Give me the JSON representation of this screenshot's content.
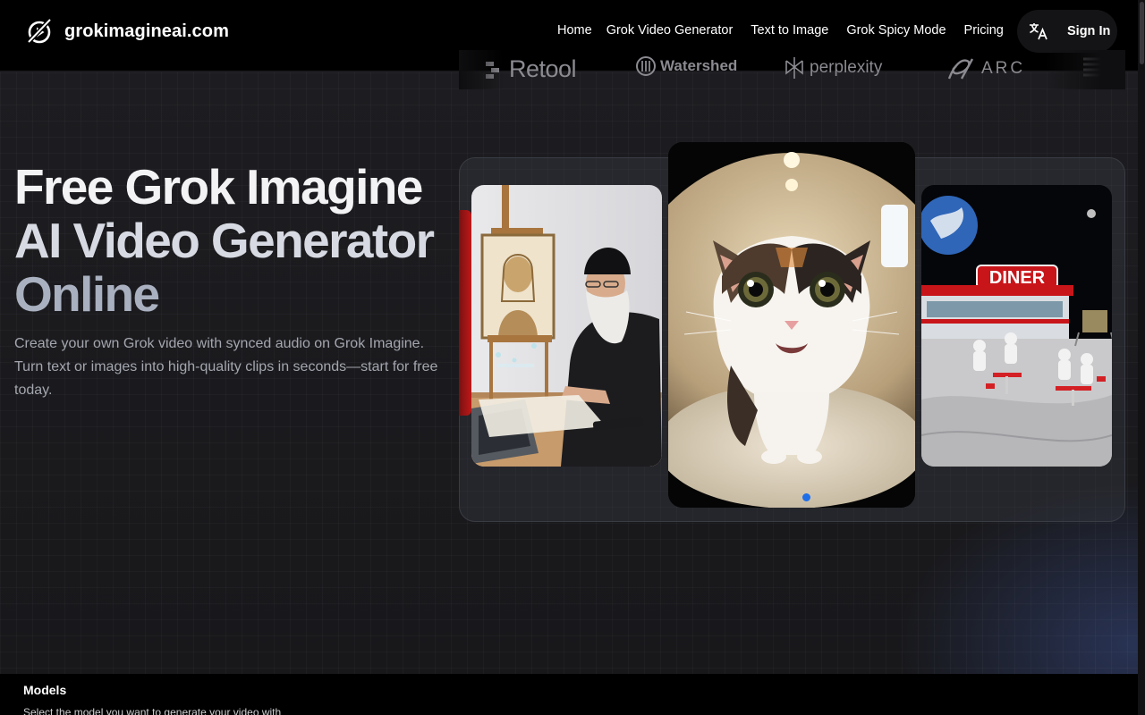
{
  "header": {
    "brand": "grokimagineai.com",
    "nav": [
      "Home",
      "Grok Video Generator",
      "Text to Image",
      "Grok Spicy Mode",
      "Pricing"
    ],
    "sign_in": "Sign In",
    "language_icon": "translate-icon"
  },
  "logos": {
    "items": [
      "Retool",
      "Watershed",
      "perplexity",
      "ARC"
    ]
  },
  "hero": {
    "title_line1": "Free Grok Imagine",
    "title_line2": "AI Video Generator",
    "title_line3": "Online",
    "subtitle": "Create your own Grok video with synced audio on Grok Imagine. Turn text or images into high-quality clips in seconds—start for free today."
  },
  "gallery": {
    "diner_sign": "DINER",
    "active_index": 1
  },
  "models": {
    "title": "Models",
    "description": "Select the model you want to generate your video with"
  },
  "colors": {
    "accent": "#1e6ee8",
    "background": "#1a1a1d",
    "topbar": "#000000"
  }
}
